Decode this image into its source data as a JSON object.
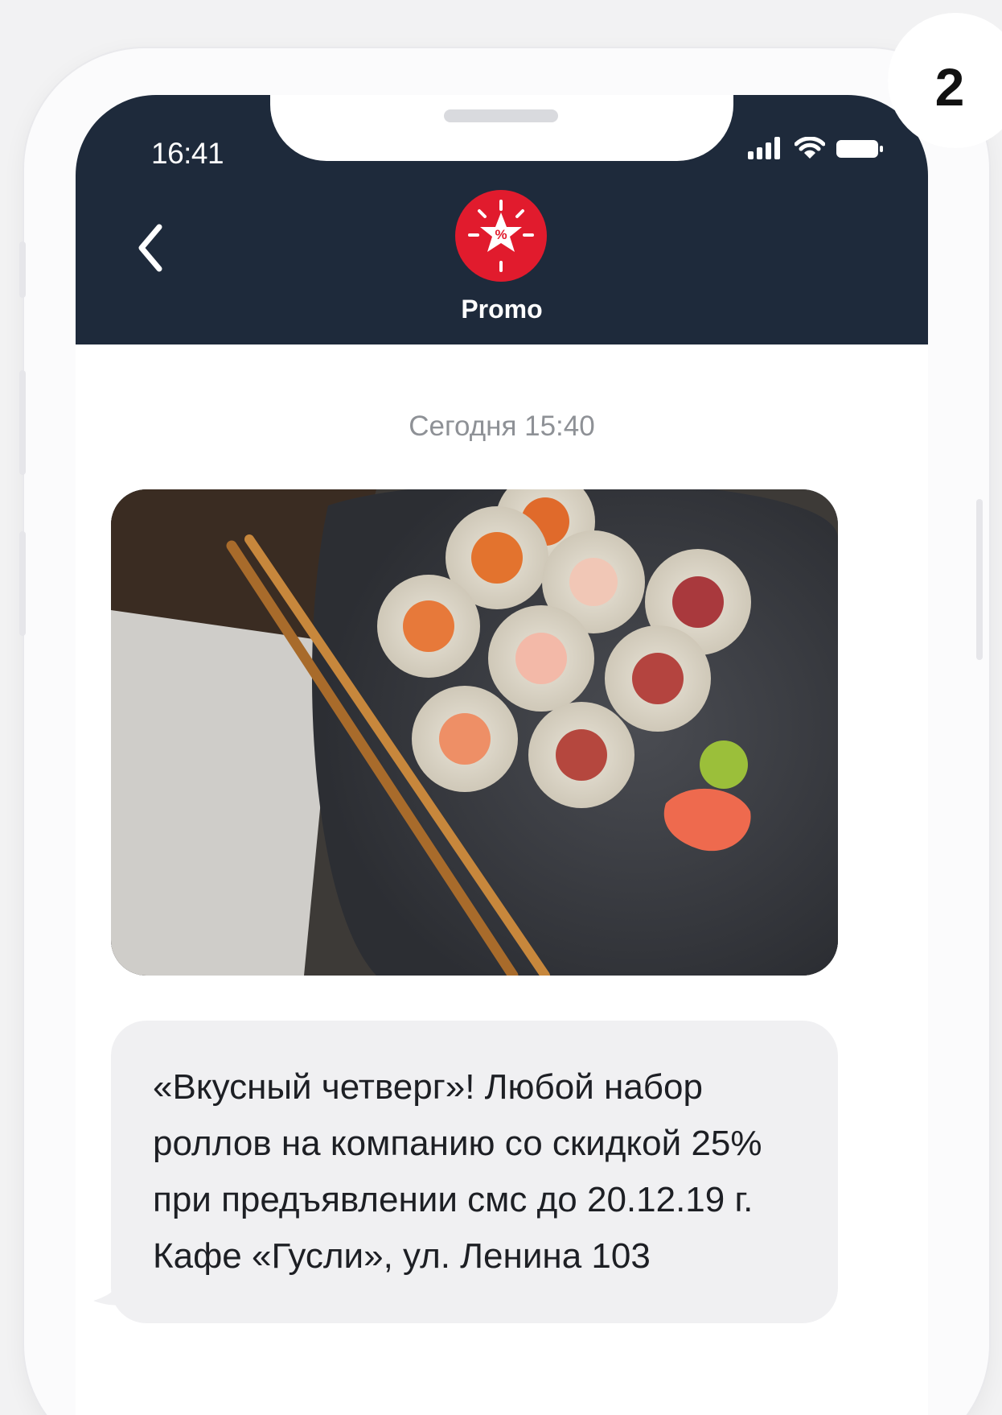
{
  "step_badge": "2",
  "status_bar": {
    "time": "16:41",
    "icons": [
      "cellular-signal-icon",
      "wifi-icon",
      "battery-icon"
    ]
  },
  "header": {
    "back_icon": "chevron-left-icon",
    "sender_avatar_icon": "star-percent-icon",
    "sender_name": "Promo",
    "avatar_color": "#e11b2d",
    "background_color": "#1e2a3b"
  },
  "conversation": {
    "timestamp": "Сегодня 15:40",
    "image_alt": "sushi rolls on a plate with chopsticks",
    "message_lines": [
      "«Вкусный четверг»! Любой набор",
      "роллов на компанию со скидкой 25%",
      "при предъявлении смс до 20.12.19 г.",
      "Кафе «Гусли», ул. Ленина 103"
    ]
  }
}
